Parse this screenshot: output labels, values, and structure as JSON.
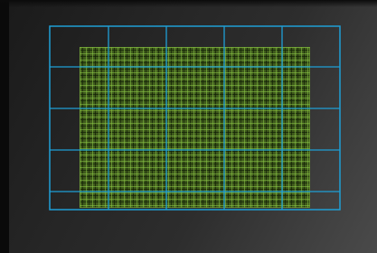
{
  "viewfinder": {
    "grid_color": "#1f9fd6",
    "sensor_color": "#3f5a1c",
    "grid_columns": 5,
    "grid_rows": 5
  }
}
